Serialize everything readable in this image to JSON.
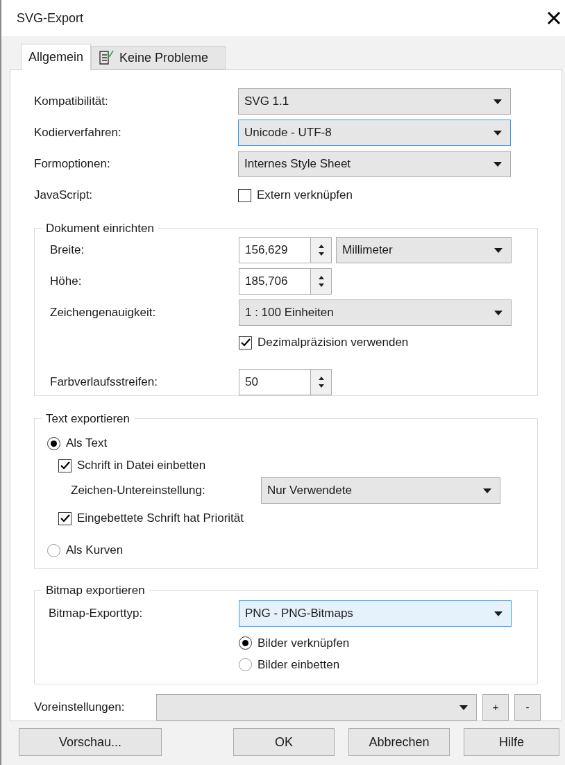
{
  "window": {
    "title": "SVG-Export"
  },
  "tabs": [
    {
      "label": "Allgemein",
      "selected": true,
      "icon": false
    },
    {
      "label": "Keine Probleme",
      "selected": false,
      "icon": true
    }
  ],
  "general": [
    {
      "kind": "combo",
      "label": "Kompatibilität:",
      "value": "SVG 1.1",
      "focused": false,
      "hover": false
    },
    {
      "kind": "combo",
      "label": "Kodierverfahren:",
      "value": "Unicode - UTF-8",
      "focused": true,
      "hover": false
    },
    {
      "kind": "combo",
      "label": "Formoptionen:",
      "value": "Internes Style Sheet",
      "focused": false,
      "hover": false
    },
    {
      "kind": "checkbox",
      "label": "JavaScript:",
      "option": "Extern verknüpfen",
      "checked": false
    }
  ],
  "document": {
    "title": "Dokument einrichten",
    "rows": [
      {
        "kind": "spin",
        "label": "Breite:",
        "value": "156,629",
        "unit": "Millimeter"
      },
      {
        "kind": "spin",
        "label": "Höhe:",
        "value": "185,706"
      },
      {
        "kind": "combo",
        "label": "Zeichengenauigkeit:",
        "value": "1 : 100 Einheiten",
        "focused": false,
        "hover": false
      },
      {
        "kind": "checkbox",
        "option": "Dezimalpräzision verwenden",
        "checked": true
      },
      {
        "kind": "spin",
        "label": "Farbverlaufsstreifen:",
        "value": "50"
      }
    ]
  },
  "text_export": {
    "title": "Text exportieren",
    "options": [
      {
        "kind": "radio",
        "label": "Als Text",
        "selected": true
      },
      {
        "kind": "checkbox",
        "label": "Schrift in Datei einbetten",
        "checked": true
      },
      {
        "kind": "combo",
        "label": "Zeichen-Untereinstellung:",
        "value": "Nur Verwendete",
        "focused": false,
        "hover": false
      },
      {
        "kind": "checkbox",
        "label": "Eingebettete Schrift hat Priorität",
        "checked": true
      },
      {
        "kind": "radio",
        "label": "Als Kurven",
        "selected": false
      }
    ]
  },
  "bitmap_export": {
    "title": "Bitmap exportieren",
    "type": {
      "label": "Bitmap-Exporttyp:",
      "value": "PNG - PNG-Bitmaps",
      "focused": true,
      "hover": true
    },
    "options": [
      {
        "label": "Bilder verknüpfen",
        "selected": true
      },
      {
        "label": "Bilder einbetten",
        "selected": false
      }
    ]
  },
  "presets": {
    "label": "Voreinstellungen:",
    "add": "+",
    "remove": "-"
  },
  "buttons": [
    "Vorschau...",
    "OK",
    "Abbrechen",
    "Hilfe"
  ]
}
